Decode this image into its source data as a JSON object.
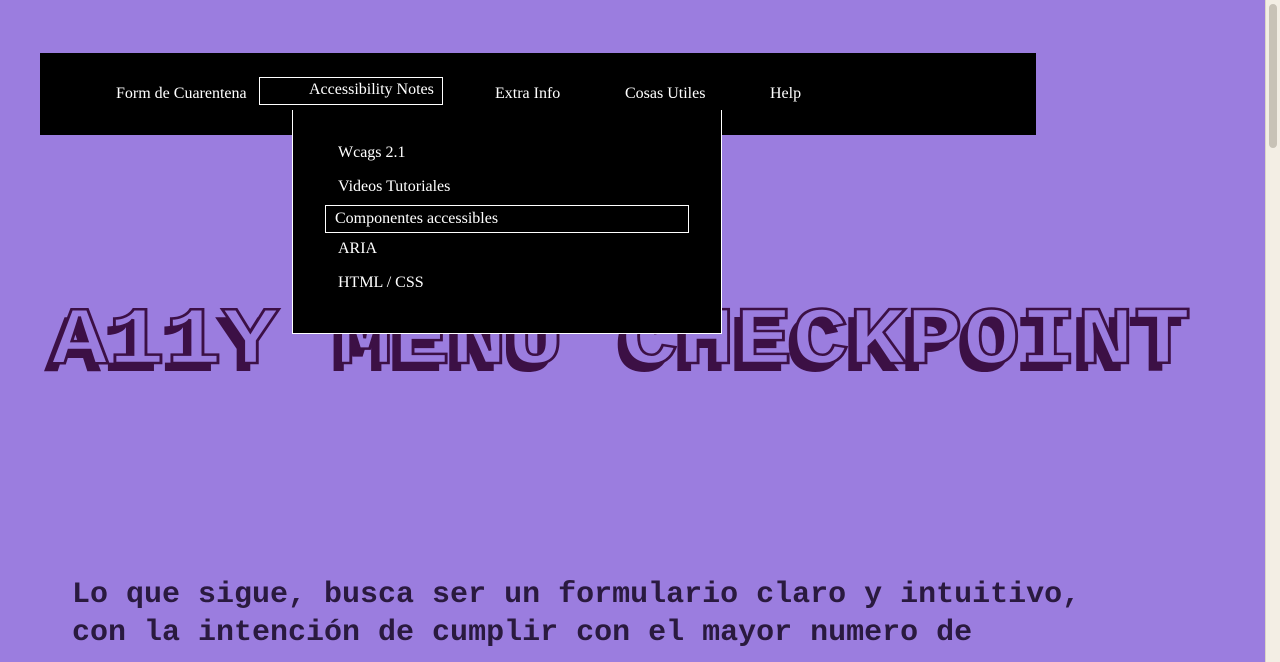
{
  "nav": {
    "items": [
      {
        "label": "Form de Cuarentena"
      },
      {
        "label": "Accessibility Notes"
      },
      {
        "label": "Extra Info"
      },
      {
        "label": "Cosas Utiles"
      },
      {
        "label": "Help"
      }
    ],
    "dropdown": [
      {
        "label": "Wcags 2.1"
      },
      {
        "label": "Videos Tutoriales"
      },
      {
        "label": "Componentes accessibles"
      },
      {
        "label": "ARIA"
      },
      {
        "label": "HTML / CSS"
      }
    ]
  },
  "hero": {
    "title": "A11Y MENU CHECKPOINT"
  },
  "intro": {
    "line1": "Lo que sigue, busca ser un formulario claro y intuitivo,",
    "line2": "con la intención de cumplir con el mayor numero de"
  },
  "colors": {
    "background": "#9b7ddf",
    "title_outline": "#3c1045",
    "nav": "#000000"
  }
}
